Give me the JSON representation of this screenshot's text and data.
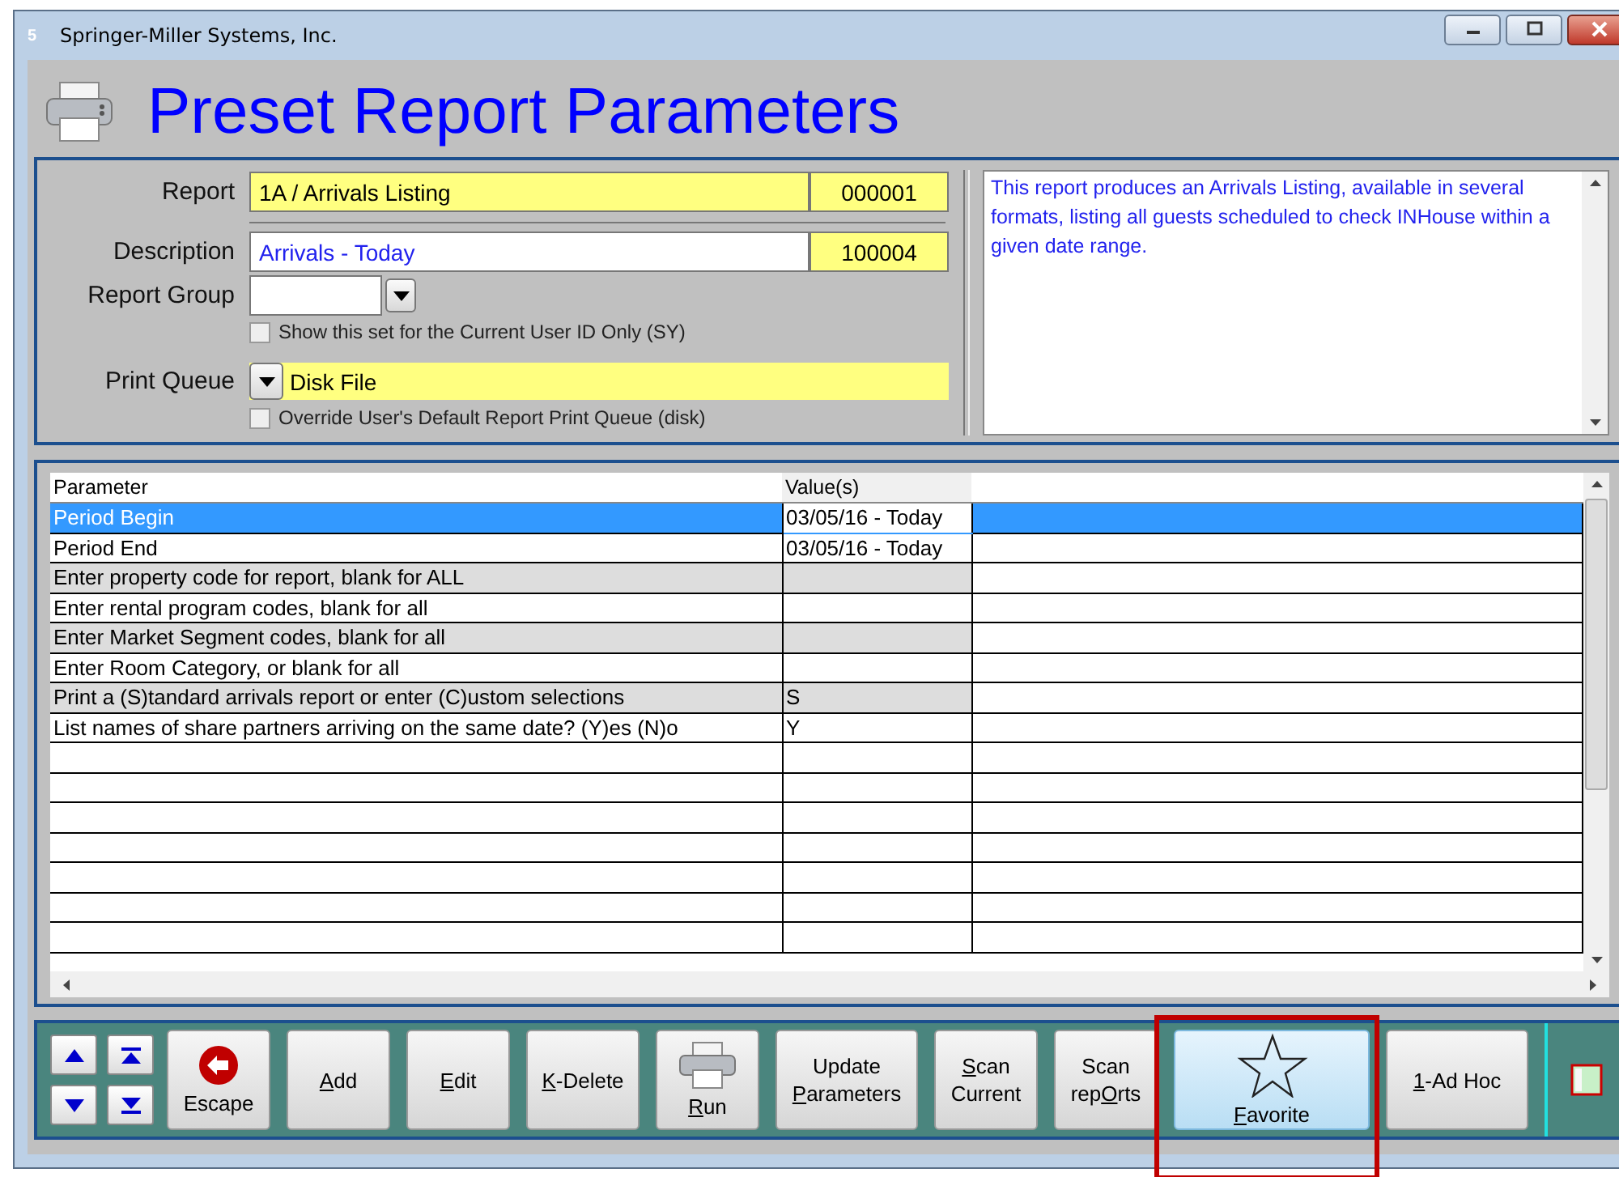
{
  "window": {
    "badge": "5",
    "title": "Springer-Miller Systems, Inc."
  },
  "heading": "Preset Report Parameters",
  "form": {
    "report": {
      "label": "Report",
      "value": "1A / Arrivals Listing",
      "code": "000001"
    },
    "description": {
      "label": "Description",
      "value": "Arrivals - Today",
      "code": "100004"
    },
    "report_group": {
      "label": "Report Group"
    },
    "current_user_only": {
      "label": "Show this set for the Current User ID Only (SY)",
      "checked": false
    },
    "print_queue": {
      "label": "Print Queue",
      "value": "Disk File"
    },
    "override_queue": {
      "label": "Override User's Default Report Print Queue (disk)",
      "checked": false
    },
    "info": "This report produces an Arrivals Listing, available in several formats, listing all guests scheduled to check INHouse within a given date range."
  },
  "table": {
    "columns": [
      "Parameter",
      "Value(s)"
    ],
    "rows": [
      {
        "parameter": "Period Begin",
        "value": "03/05/16 - Today",
        "selected": true,
        "shaded": false
      },
      {
        "parameter": "Period End",
        "value": "03/05/16 - Today",
        "selected": false,
        "shaded": false
      },
      {
        "parameter": "Enter property code for report, blank for ALL",
        "value": "",
        "selected": false,
        "shaded": true
      },
      {
        "parameter": "Enter rental program codes, blank for all",
        "value": "",
        "selected": false,
        "shaded": false
      },
      {
        "parameter": "Enter Market Segment codes, blank for all",
        "value": "",
        "selected": false,
        "shaded": true
      },
      {
        "parameter": "Enter Room Category, or blank for all",
        "value": "",
        "selected": false,
        "shaded": false
      },
      {
        "parameter": "Print a (S)tandard arrivals report or enter (C)ustom selections",
        "value": "S",
        "selected": false,
        "shaded": true
      },
      {
        "parameter": "List names of share partners arriving on the same date?  (Y)es (N)o",
        "value": "Y",
        "selected": false,
        "shaded": false
      }
    ]
  },
  "toolbar": [
    {
      "kind": "escape",
      "pre": "Escape",
      "selected": false
    },
    {
      "kind": "text",
      "key": "A",
      "post": "dd",
      "selected": false
    },
    {
      "kind": "text",
      "key": "E",
      "post": "dit",
      "selected": false
    },
    {
      "kind": "text",
      "key": "K",
      "post": "-Delete",
      "selected": false
    },
    {
      "kind": "run",
      "key": "R",
      "post": "un",
      "selected": false
    },
    {
      "kind": "text",
      "pre": "Update ",
      "key": "P",
      "post": "arameters",
      "selected": false
    },
    {
      "kind": "text",
      "key": "S",
      "post": "can Current",
      "selected": false
    },
    {
      "kind": "text",
      "pre": "Scan rep",
      "key": "O",
      "post": "rts",
      "selected": false
    },
    {
      "kind": "favorite",
      "key": "F",
      "post": "avorite",
      "selected": true
    },
    {
      "kind": "text",
      "key": "1",
      "post": "-Ad Hoc",
      "selected": false
    }
  ]
}
